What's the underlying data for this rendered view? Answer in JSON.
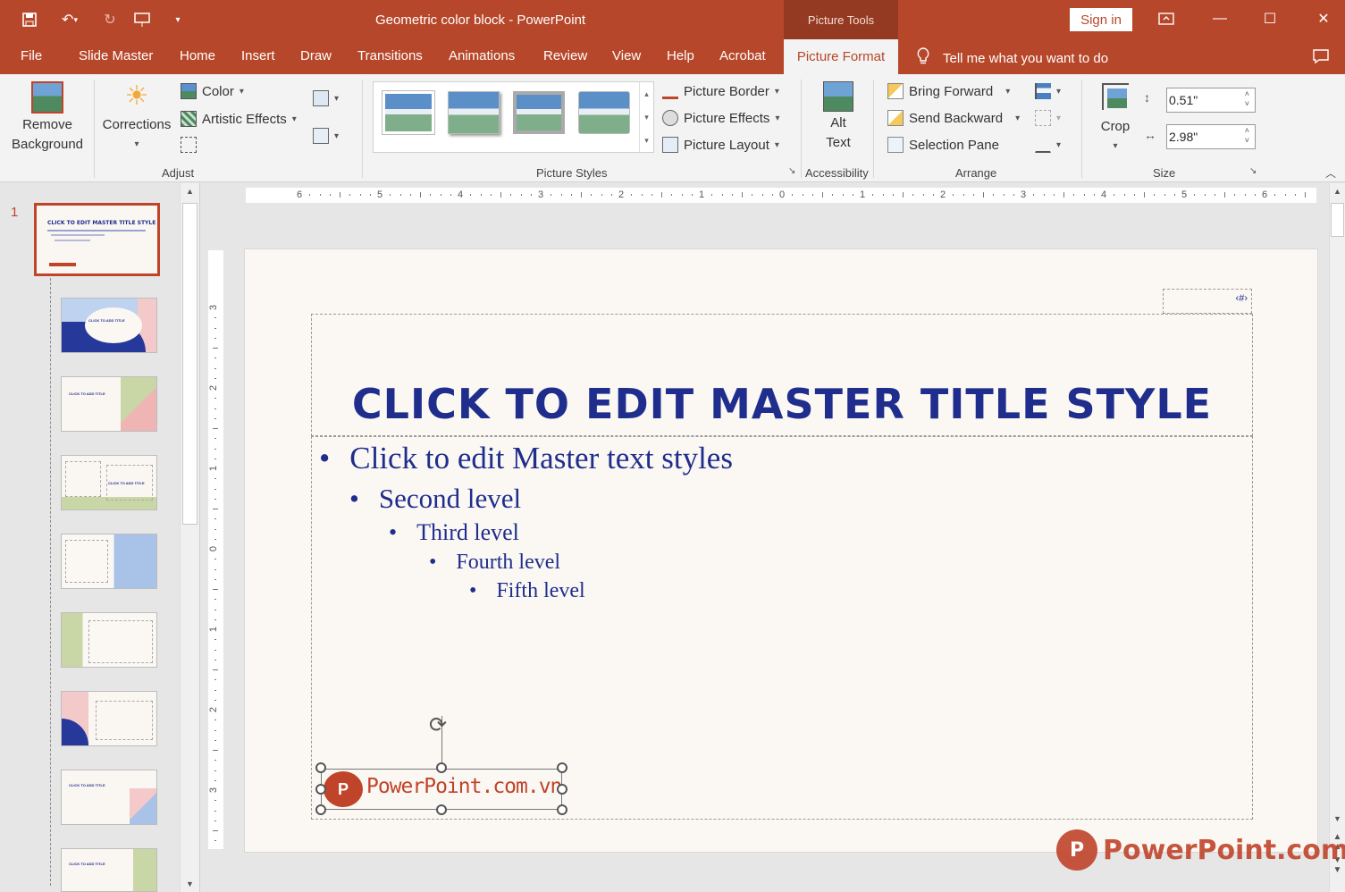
{
  "window": {
    "title": "Geometric color block  -  PowerPoint",
    "context_label": "Picture Tools",
    "signin": "Sign in"
  },
  "tabs": [
    "File",
    "Slide Master",
    "Home",
    "Insert",
    "Draw",
    "Transitions",
    "Animations",
    "Review",
    "View",
    "Help",
    "Acrobat"
  ],
  "active_tab": "Picture Format",
  "tellme": "Tell me what you want to do",
  "ribbon": {
    "remove_bg": [
      "Remove",
      "Background"
    ],
    "corrections": "Corrections",
    "color": "Color",
    "artistic_effects": "Artistic Effects",
    "adjust_label": "Adjust",
    "picture_border": "Picture Border",
    "picture_effects": "Picture Effects",
    "picture_layout": "Picture Layout",
    "picture_styles_label": "Picture Styles",
    "alt_text": [
      "Alt",
      "Text"
    ],
    "accessibility_label": "Accessibility",
    "bring_forward": "Bring Forward",
    "send_backward": "Send Backward",
    "selection_pane": "Selection Pane",
    "arrange_label": "Arrange",
    "crop": "Crop",
    "height": "0.51\"",
    "width": "2.98\"",
    "size_label": "Size"
  },
  "thumbnails": {
    "selected_number": "1",
    "thumb_title": "CLICK TO EDIT MASTER TITLE STYLE",
    "layout_title": "CLICK TO ADD TITLE"
  },
  "rulers": {
    "h_ticks": [
      "6",
      "5",
      "4",
      "3",
      "2",
      "1",
      "0",
      "1",
      "2",
      "3",
      "4",
      "5",
      "6"
    ],
    "v_ticks": [
      "3",
      "2",
      "1",
      "0",
      "1",
      "2",
      "3"
    ]
  },
  "slide": {
    "title": "CLICK TO EDIT MASTER TITLE STYLE",
    "levels": [
      "Click to edit Master text styles",
      "Second level",
      "Third level",
      "Fourth level",
      "Fifth level"
    ],
    "logo_text": "PowerPoint.com.vn"
  },
  "watermark": "PowerPoint.com.vn",
  "colors": {
    "accent": "#b7472a",
    "title_blue": "#1f2d8c"
  }
}
